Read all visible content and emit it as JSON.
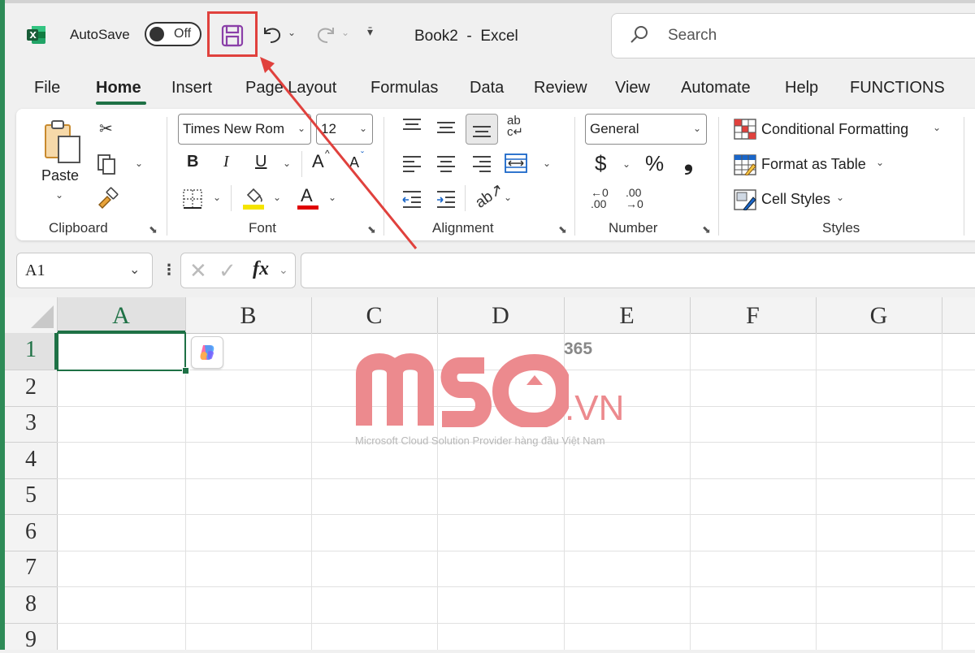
{
  "titlebar": {
    "autosave_label": "AutoSave",
    "autosave_state": "Off",
    "document_title": "Book2  -  Excel",
    "search_placeholder": "Search",
    "icons": [
      "excel-logo-icon",
      "save-icon",
      "undo-icon",
      "redo-icon",
      "customize-qat-icon",
      "search-icon"
    ]
  },
  "tabs": [
    "File",
    "Home",
    "Insert",
    "Page Layout",
    "Formulas",
    "Data",
    "Review",
    "View",
    "Automate",
    "Help",
    "FUNCTIONS"
  ],
  "active_tab": "Home",
  "ribbon": {
    "clipboard": {
      "label": "Clipboard",
      "paste_label": "Paste"
    },
    "font": {
      "label": "Font",
      "font_name": "Times New Rom",
      "font_size": "12",
      "bold": "B",
      "italic": "I",
      "underline": "U",
      "grow": "A",
      "shrink": "A",
      "font_color_letter": "A"
    },
    "alignment": {
      "label": "Alignment"
    },
    "number": {
      "label": "Number",
      "format": "General",
      "currency": "$",
      "percent": "%",
      "comma": "❟",
      "inc_decimal_top": "←0",
      "inc_decimal_bottom": ".00",
      "dec_decimal_top": ".00",
      "dec_decimal_bottom": "→0"
    },
    "styles": {
      "label": "Styles",
      "conditional_formatting": "Conditional Formatting",
      "format_as_table": "Format as Table",
      "cell_styles": "Cell Styles"
    },
    "accent_colors": {
      "highlight": "#f5e400",
      "font_color": "#e00000",
      "brand_green": "#1e7145"
    }
  },
  "formula_bar": {
    "name_box": "A1",
    "fx": "fx",
    "content": ""
  },
  "sheet": {
    "columns": [
      "A",
      "B",
      "C",
      "D",
      "E",
      "F",
      "G"
    ],
    "rows": [
      "1",
      "2",
      "3",
      "4",
      "5",
      "6",
      "7",
      "8",
      "9"
    ],
    "selected_cell": "A1"
  },
  "watermark": {
    "brand": "MSO",
    "suffix": "365",
    "domain": ".VN",
    "tagline": "Microsoft Cloud Solution Provider hàng đầu Việt Nam",
    "color": "#ec8a8e"
  },
  "annotation": {
    "highlight_color": "#e0413d",
    "target": "save-button"
  }
}
